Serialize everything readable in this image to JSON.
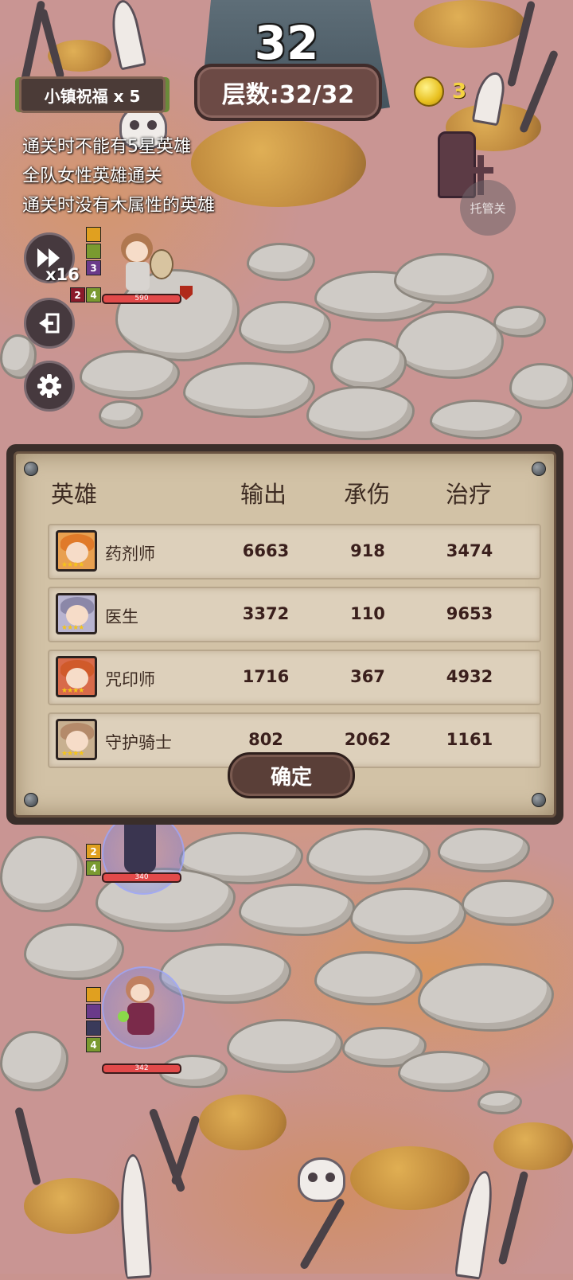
{
  "hud": {
    "turn_count": "32",
    "floor_label": "层数:32/32",
    "blessing": "小镇祝福 x 5",
    "coins": "3",
    "auto_button": "托管关",
    "speed_label": "x16"
  },
  "conditions": [
    "通关时不能有5星英雄",
    "全队女性英雄通关",
    "通关时没有木属性的英雄"
  ],
  "units": [
    {
      "hp": "590",
      "skill_levels": [
        "3",
        "2",
        "4"
      ]
    },
    {
      "hp": "340",
      "skill_levels": [
        "2",
        "4"
      ]
    },
    {
      "hp": "342",
      "skill_levels": [
        "4"
      ]
    }
  ],
  "stats_panel": {
    "headers": {
      "hero": "英雄",
      "damage": "输出",
      "taken": "承伤",
      "heal": "治疗"
    },
    "rows": [
      {
        "name": "药剂师",
        "damage": "6663",
        "taken": "918",
        "heal": "3474",
        "hair_color": "#e07a2a"
      },
      {
        "name": "医生",
        "damage": "3372",
        "taken": "110",
        "heal": "9653",
        "hair_color": "#8b87a8"
      },
      {
        "name": "咒印师",
        "damage": "1716",
        "taken": "367",
        "heal": "4932",
        "hair_color": "#d05a2a"
      },
      {
        "name": "守护骑士",
        "damage": "802",
        "taken": "2062",
        "heal": "1161",
        "hair_color": "#b48a6a"
      }
    ],
    "confirm_label": "确定"
  },
  "icons": {
    "fast_forward": "fast-forward-icon",
    "exit": "exit-icon",
    "settings": "gear-icon",
    "coin": "coin-icon"
  }
}
